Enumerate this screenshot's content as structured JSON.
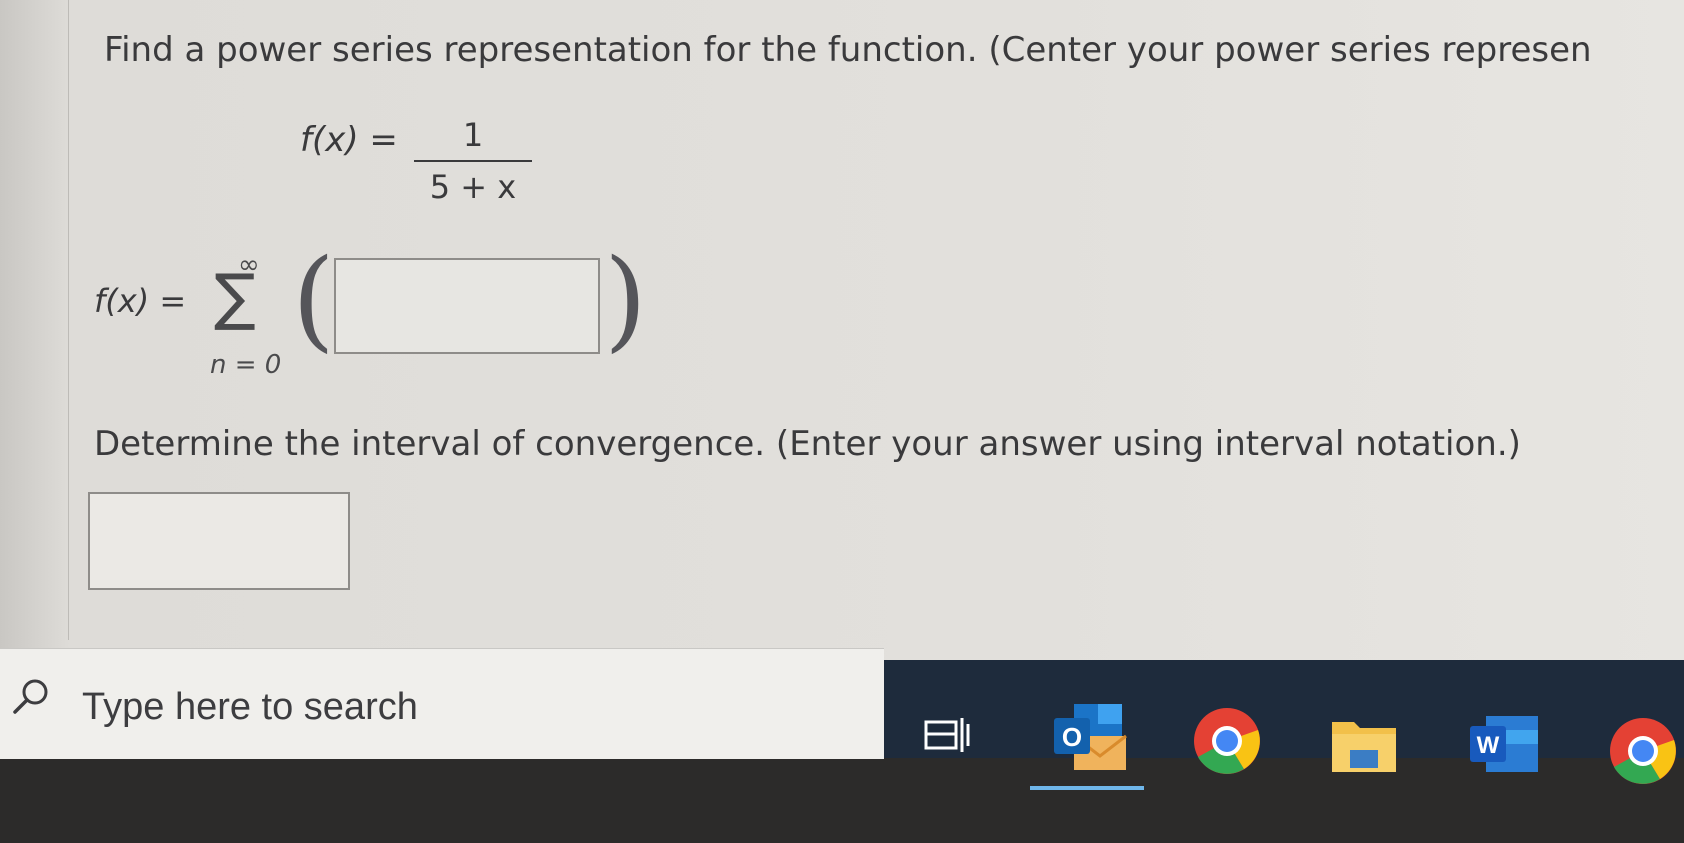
{
  "question": {
    "prompt": "Find a power series representation for the function. (Center your power series represen",
    "function_lhs": "f(x) =",
    "numerator": "1",
    "denominator": "5 + x"
  },
  "series": {
    "lhs": "f(x) =",
    "upper_limit": "∞",
    "sigma": "∑",
    "lower_limit": "n = 0",
    "left_paren": "(",
    "right_paren": ")",
    "answer_value": ""
  },
  "interval": {
    "prompt": "Determine the interval of convergence. (Enter your answer using interval notation.)",
    "answer_value": ""
  },
  "taskbar": {
    "search_placeholder": "Type here to search",
    "icons": [
      "task-view-icon",
      "outlook-icon",
      "chrome-icon",
      "file-explorer-icon",
      "word-icon",
      "chrome-icon"
    ],
    "outlook_letter": "O",
    "word_letter": "W",
    "accent_color": "#6fb6ea"
  }
}
